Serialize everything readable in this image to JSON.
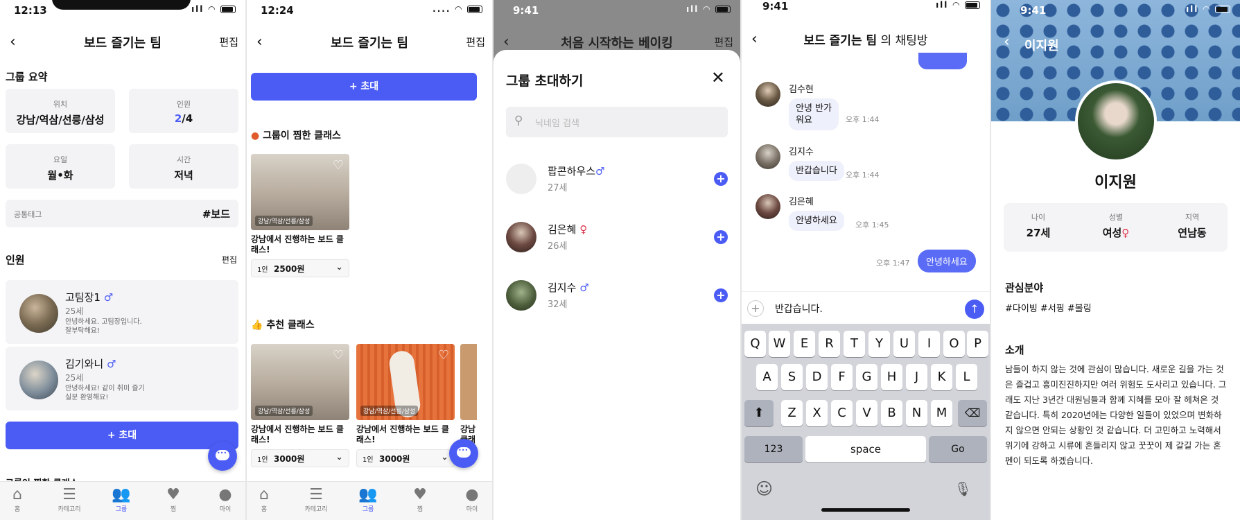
{
  "colors": {
    "accent": "#4b5cf5",
    "female": "#e0344b",
    "male": "#4b5cf5"
  },
  "screen1": {
    "status_time": "12:13",
    "title": "보드 즐기는 팀",
    "edit": "편집",
    "summary_title": "그룹 요약",
    "cards": [
      {
        "key": "위치",
        "value": "강남/역삼/선릉/삼성"
      },
      {
        "key": "인원",
        "count": "2",
        "total": "/4"
      },
      {
        "key": "요일",
        "value": "월•화"
      },
      {
        "key": "시간",
        "value": "저녁"
      }
    ],
    "tag_label": "공통태그",
    "tag_value": "#보드",
    "members_title": "인원",
    "members_edit": "편집",
    "members": [
      {
        "name": "고팀장1",
        "gender": "♂",
        "age": "25세",
        "intro": "안녕하세요. 고팀장입니다. 잘부탁해요!"
      },
      {
        "name": "김기와니",
        "gender": "♂",
        "age": "25세",
        "intro": "안녕하세요! 같이 취미 즐기실분 환영해요!"
      }
    ],
    "invite_button": "+ 초대",
    "partial_heading": "그룹이 찜한 클래스"
  },
  "tabs": [
    {
      "icon": "home-icon",
      "glyph": "⌂",
      "label": "홈"
    },
    {
      "icon": "menu-icon",
      "glyph": "☰",
      "label": "카테고리"
    },
    {
      "icon": "group-icon",
      "glyph": "👥",
      "label": "그룹"
    },
    {
      "icon": "heart-icon",
      "glyph": "♥",
      "label": "찜"
    },
    {
      "icon": "person-icon",
      "glyph": "●",
      "label": "마이"
    }
  ],
  "screen2": {
    "status_time": "12:24",
    "title": "보드 즐기는 팀",
    "edit": "편집",
    "invite_button": "+ 초대",
    "favorites_title": "그룹이 찜한 클래스",
    "favorites": [
      {
        "loc": "강남/역삼/선릉/삼성",
        "title": "강남에서 진행하는 보드 클래스!",
        "pp": "1인",
        "price": "2500원"
      }
    ],
    "recommend_title": "추천 클래스",
    "recommend": [
      {
        "loc": "강남/역삼/선릉/삼성",
        "title": "강남에서 진행하는 보드 클래스!",
        "pp": "1인",
        "price": "3000원"
      },
      {
        "loc": "강남/역삼/선릉/삼성",
        "title": "강남에서 진행하는 보드 클래스!",
        "pp": "1인",
        "price": "3000원"
      },
      {
        "title": "강남 클래"
      }
    ]
  },
  "screen3": {
    "status_time": "9:41",
    "bg_title": "처음 시작하는 베이킹",
    "bg_edit": "편집",
    "modal_title": "그룹 초대하기",
    "search_placeholder": "닉네임 검색",
    "users": [
      {
        "name": "팝콘하우스",
        "gender": "♂",
        "age": "27세"
      },
      {
        "name": "김은혜",
        "gender": "♀",
        "age": "26세"
      },
      {
        "name": "김지수",
        "gender": "♂",
        "age": "32세"
      }
    ]
  },
  "screen4": {
    "status_time": "9:41",
    "title_name": "보드 즐기는 팀",
    "title_suffix": " 의 채팅방",
    "messages": [
      {
        "sender": "김수현",
        "text": "안녕 반가워요",
        "time": "오후 1:44"
      },
      {
        "sender": "김지수",
        "text": "반갑습니다",
        "time": "오후 1:44"
      },
      {
        "sender": "김은혜",
        "text": "안녕하세요",
        "time": "오후 1:45"
      }
    ],
    "my_message": {
      "text": "안녕하세요",
      "time": "오후 1:47"
    },
    "input_value": "반갑습니다.",
    "keyboard": {
      "row1": [
        "Q",
        "W",
        "E",
        "R",
        "T",
        "Y",
        "U",
        "I",
        "O",
        "P"
      ],
      "row2": [
        "A",
        "S",
        "D",
        "F",
        "G",
        "H",
        "J",
        "K",
        "L"
      ],
      "row3": [
        "Z",
        "X",
        "C",
        "V",
        "B",
        "N",
        "M"
      ],
      "num": "123",
      "space": "space",
      "go": "Go"
    }
  },
  "screen5": {
    "status_time": "9:41",
    "header_name": "이지원",
    "name": "이지원",
    "stats": [
      {
        "key": "나이",
        "value": "27세"
      },
      {
        "key": "성별",
        "value": "여성",
        "symbol": "♀"
      },
      {
        "key": "지역",
        "value": "연남동"
      }
    ],
    "interest_title": "관심분야",
    "interests": "#다이빙 #서핑 #볼링",
    "bio_title": "소개",
    "bio": "남들이 하지 않는 것에 관심이 많습니다. 새로운 길을 가는 것은 즐겁고 흥미진진하지만 여러 위험도 도사리고 있습니다. 그래도 지난 3년간 대원님들과 함께 지혜를 모아 잘 헤쳐온 것 같습니다. 특히 2020년에는 다양한 일들이 있었으며 변화하지 않으면 안되는 상황인 것 같습니다. 더 고민하고 노력해서 위기에 강하고 시류에 흔들리지 않고 꿋꿋이 제 갈길 가는 혼펜이 되도록 하겠습니다."
  }
}
